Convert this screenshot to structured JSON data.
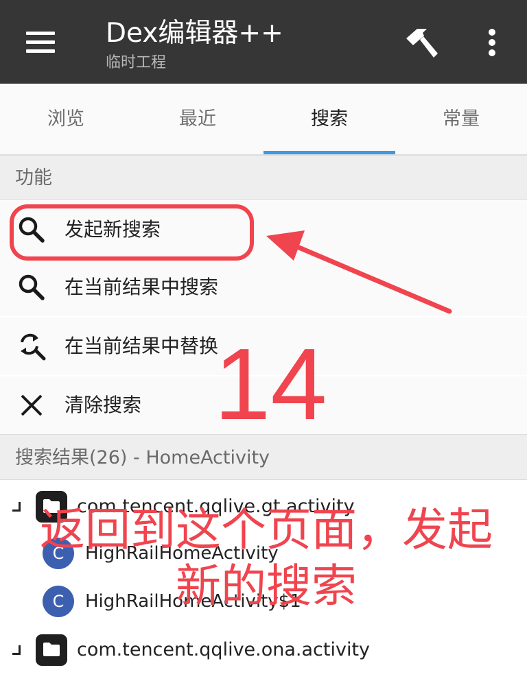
{
  "appbar": {
    "title": "Dex编辑器++",
    "subtitle": "临时工程",
    "menu_icon": "hamburger-menu-icon",
    "build_icon": "hammer-icon",
    "more_icon": "more-vertical-icon"
  },
  "tabs": [
    {
      "label": "浏览",
      "active": false
    },
    {
      "label": "最近",
      "active": false
    },
    {
      "label": "搜索",
      "active": true
    },
    {
      "label": "常量",
      "active": false
    }
  ],
  "functions": {
    "header": "功能",
    "items": [
      {
        "label": "发起新搜索",
        "icon": "search-icon"
      },
      {
        "label": "在当前结果中搜索",
        "icon": "search-icon"
      },
      {
        "label": "在当前结果中替换",
        "icon": "search-replace-icon"
      },
      {
        "label": "清除搜索",
        "icon": "close-icon"
      }
    ]
  },
  "results": {
    "header": "搜索结果(26) - HomeActivity",
    "tree": [
      {
        "type": "package",
        "label": "com.tencent.qqlive.gt.activity"
      },
      {
        "type": "class",
        "badge": "C",
        "label": "HighRailHomeActivity"
      },
      {
        "type": "class",
        "badge": "C",
        "label": "HighRailHomeActivity$1"
      },
      {
        "type": "package",
        "label": "com.tencent.qqlive.ona.activity"
      }
    ]
  },
  "annotations": {
    "step_number": "14",
    "instruction": "返回到这个页面，发起新的搜索",
    "color": "#f0444e"
  },
  "colors": {
    "appbar": "#363636",
    "tab_indicator": "#3d9ae0",
    "class_badge": "#3d5fb0"
  }
}
